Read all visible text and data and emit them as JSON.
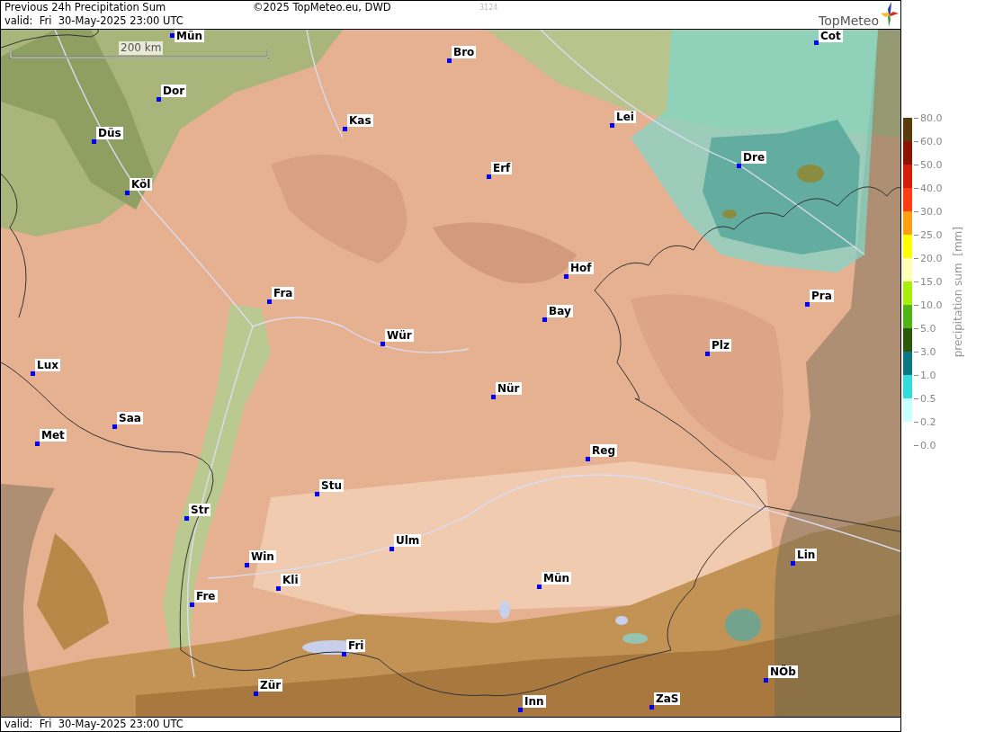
{
  "header": {
    "title": "Previous 24h Precipitation Sum",
    "valid": "valid:  Fri  30-May-2025 23:00 UTC",
    "copyright": "©2025 TopMeteo.eu, DWD",
    "number": "3124",
    "logo": "TopMeteo"
  },
  "map": {
    "scale_bar": "200 km",
    "cities": [
      {
        "label": "Mün"
      },
      {
        "label": "Cot"
      },
      {
        "label": "Bro"
      },
      {
        "label": "Dor"
      },
      {
        "label": "Lei"
      },
      {
        "label": "Kas"
      },
      {
        "label": "Düs"
      },
      {
        "label": "Dre"
      },
      {
        "label": "Erf"
      },
      {
        "label": "Köl"
      },
      {
        "label": "Hof"
      },
      {
        "label": "Fra"
      },
      {
        "label": "Pra"
      },
      {
        "label": "Bay"
      },
      {
        "label": "Wür"
      },
      {
        "label": "Plz"
      },
      {
        "label": "Lux"
      },
      {
        "label": "Nür"
      },
      {
        "label": "Saa"
      },
      {
        "label": "Met"
      },
      {
        "label": "Reg"
      },
      {
        "label": "Stu"
      },
      {
        "label": "Str"
      },
      {
        "label": "Ulm"
      },
      {
        "label": "Lin"
      },
      {
        "label": "Win"
      },
      {
        "label": "Mün"
      },
      {
        "label": "Kli"
      },
      {
        "label": "Fre"
      },
      {
        "label": "Fri"
      },
      {
        "label": "NÖb"
      },
      {
        "label": "Zür"
      },
      {
        "label": "ZaS"
      },
      {
        "label": "Inn"
      }
    ]
  },
  "legend": {
    "title": "precipitation sum  [mm]",
    "levels": [
      {
        "label": "80.0",
        "color": "#5a3c0c"
      },
      {
        "label": "60.0",
        "color": "#8c1405"
      },
      {
        "label": "50.0",
        "color": "#d41e0a"
      },
      {
        "label": "40.0",
        "color": "#ff3c14"
      },
      {
        "label": "30.0",
        "color": "#ffa014"
      },
      {
        "label": "25.0",
        "color": "#ffff00"
      },
      {
        "label": "20.0",
        "color": "#ffffb4"
      },
      {
        "label": "15.0",
        "color": "#a8f00a"
      },
      {
        "label": "10.0",
        "color": "#50b414"
      },
      {
        "label": "5.0",
        "color": "#2d5a0a"
      },
      {
        "label": "3.0",
        "color": "#0a7882"
      },
      {
        "label": "1.0",
        "color": "#32dcdc"
      },
      {
        "label": "0.5",
        "color": "#c8ffff"
      },
      {
        "label": "0.2"
      },
      {
        "label": "0.0"
      }
    ]
  },
  "footer": {
    "valid": "valid:  Fri  30-May-2025 23:00 UTC"
  }
}
